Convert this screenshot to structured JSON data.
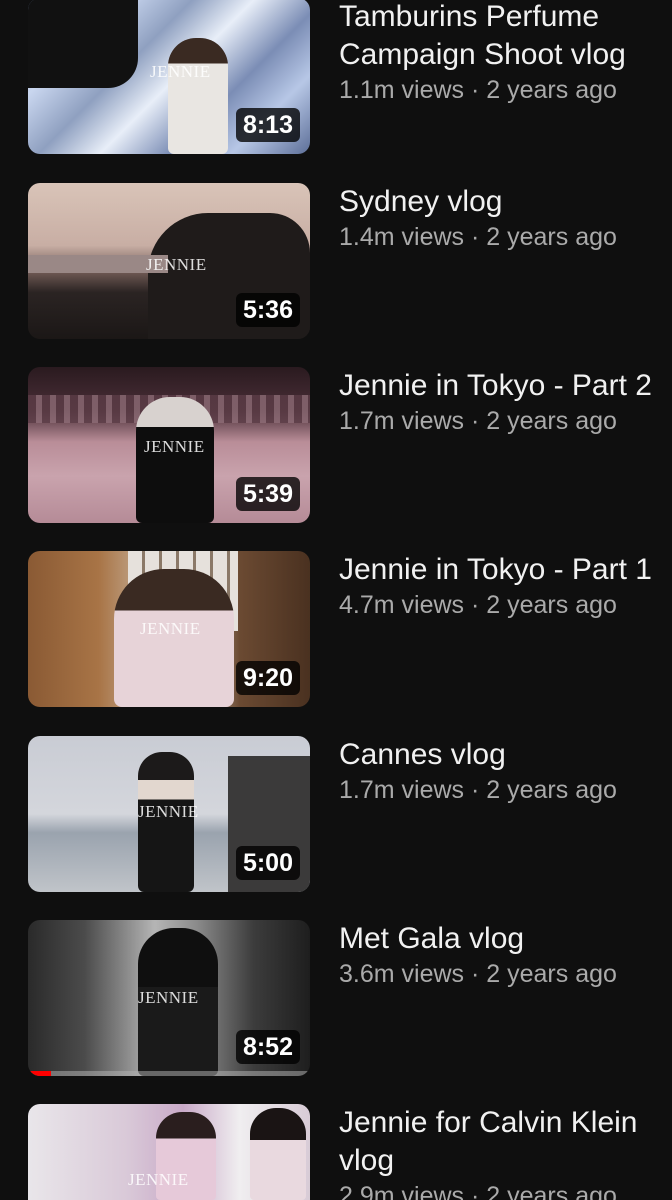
{
  "videos": [
    {
      "title": "Tamburins Perfume Campaign Shoot vlog",
      "views": "1.1m views",
      "age": "2 years ago",
      "duration": "8:13",
      "watermark": "JENNIE",
      "progress": 0
    },
    {
      "title": "Sydney vlog",
      "views": "1.4m views",
      "age": "2 years ago",
      "duration": "5:36",
      "watermark": "JENNIE",
      "progress": 0
    },
    {
      "title": "Jennie in Tokyo - Part 2",
      "views": "1.7m views",
      "age": "2 years ago",
      "duration": "5:39",
      "watermark": "JENNIE",
      "progress": 0
    },
    {
      "title": "Jennie in Tokyo - Part 1",
      "views": "4.7m views",
      "age": "2 years ago",
      "duration": "9:20",
      "watermark": "JENNIE",
      "progress": 0
    },
    {
      "title": "Cannes vlog",
      "views": "1.7m views",
      "age": "2 years ago",
      "duration": "5:00",
      "watermark": "JENNIE",
      "progress": 0
    },
    {
      "title": "Met Gala vlog",
      "views": "3.6m views",
      "age": "2 years ago",
      "duration": "8:52",
      "watermark": "JENNIE",
      "progress": 0.08
    },
    {
      "title": "Jennie for Calvin Klein vlog",
      "views": "2.9m views",
      "age": "2 years ago",
      "duration": "",
      "watermark": "JENNIE",
      "progress": 0
    }
  ],
  "separator": " · "
}
